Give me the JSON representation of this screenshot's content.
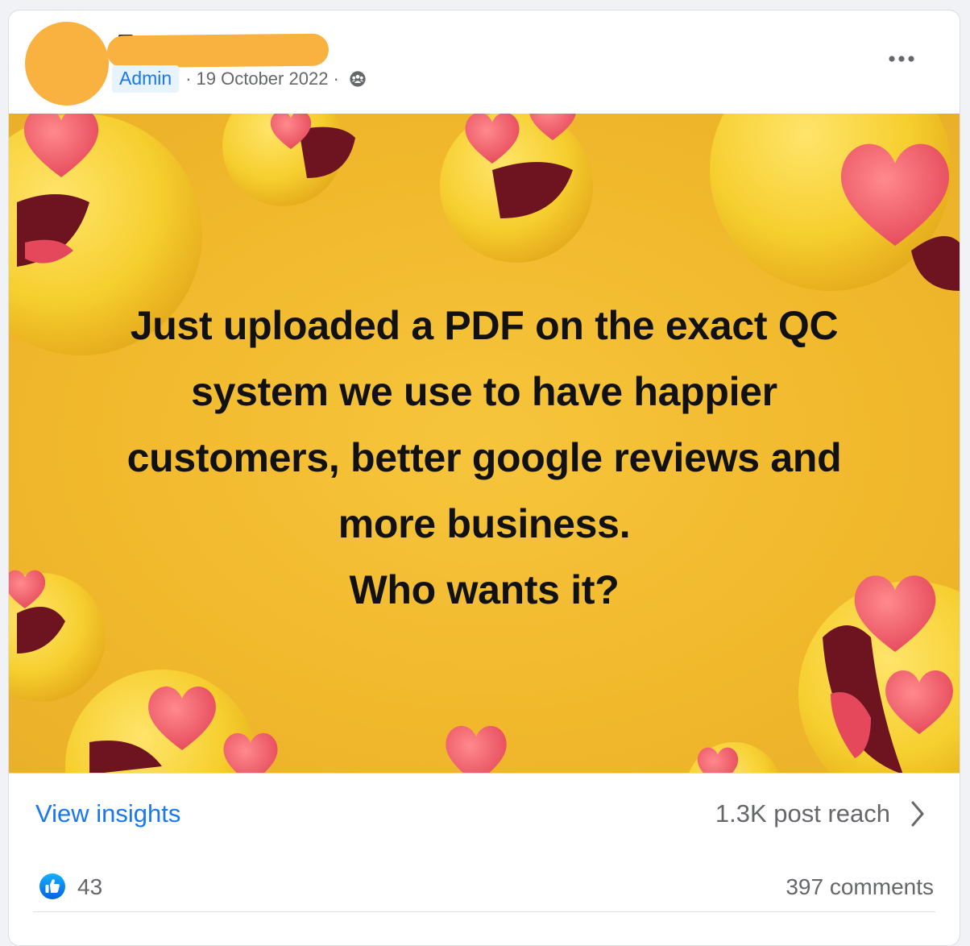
{
  "post": {
    "author_role": "Admin",
    "separator": "·",
    "date": "19 October 2022",
    "audience_icon": "group-icon",
    "more_icon": "more-options-icon"
  },
  "image": {
    "lines": [
      "Just uploaded a PDF on the exact QC",
      "system we use to have happier",
      "customers, better google reviews and",
      "more business.",
      "Who wants it?"
    ],
    "background_color": "#f1b82c",
    "decoration": "heart-eyes-emoji-pattern"
  },
  "insights": {
    "link_label": "View insights",
    "reach_label": "1.3K post reach",
    "chevron_icon": "chevron-right-icon"
  },
  "engagement": {
    "reaction_icon": "like-icon",
    "like_count": "43",
    "comments_label": "397 comments"
  },
  "colors": {
    "accent": "#1877f2",
    "redaction": "#f9b13f",
    "secondary_text": "#65676b"
  }
}
